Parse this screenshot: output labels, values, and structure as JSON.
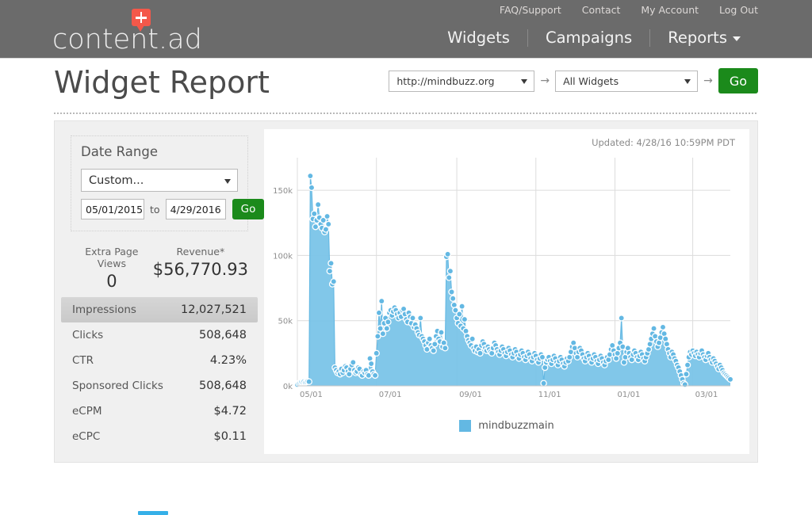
{
  "header": {
    "logo_text": "content.ad",
    "logo_icon": "speech-bubble-plus-icon",
    "top_links": [
      {
        "label": "FAQ/Support"
      },
      {
        "label": "Contact"
      },
      {
        "label": "My Account"
      },
      {
        "label": "Log Out"
      }
    ],
    "nav": [
      {
        "label": "Widgets",
        "has_caret": false
      },
      {
        "label": "Campaigns",
        "has_caret": false
      },
      {
        "label": "Reports",
        "has_caret": true
      }
    ]
  },
  "page": {
    "title": "Widget Report"
  },
  "selector": {
    "site_value": "http://mindbuzz.org",
    "widget_value": "All Widgets",
    "arrow": "→",
    "go_label": "Go"
  },
  "date_range": {
    "title": "Date Range",
    "preset_value": "Custom...",
    "start_date": "05/01/2015",
    "to_label": "to",
    "end_date": "4/29/2016",
    "go_label": "Go"
  },
  "top_stats": [
    {
      "label": "Extra Page Views",
      "value": "0"
    },
    {
      "label": "Revenue*",
      "value": "$56,770.93"
    }
  ],
  "metrics": [
    {
      "label": "Impressions",
      "value": "12,027,521",
      "highlight": true
    },
    {
      "label": "Clicks",
      "value": "508,648",
      "highlight": false
    },
    {
      "label": "CTR",
      "value": "4.23%",
      "highlight": false
    },
    {
      "label": "Sponsored Clicks",
      "value": "508,648",
      "highlight": false
    },
    {
      "label": "eCPM",
      "value": "$4.72",
      "highlight": false
    },
    {
      "label": "eCPC",
      "value": "$0.11",
      "highlight": false
    }
  ],
  "chart_panel": {
    "updated_text": "Updated: 4/28/16 10:59PM PDT"
  },
  "colors": {
    "series_blue": "#63b8e3",
    "series_fill": "#7ac4e8",
    "go_green": "#1b8a1b",
    "header_gray": "#6b6b6b",
    "logo_red": "#f4584a"
  },
  "chart_data": {
    "type": "area",
    "title": "",
    "xlabel": "",
    "ylabel": "",
    "grid": true,
    "legend_position": "bottom",
    "ylim": [
      0,
      175000
    ],
    "ytick_labels": [
      "0k",
      "50k",
      "100k",
      "150k"
    ],
    "ytick_values": [
      0,
      50000,
      100000,
      150000
    ],
    "xtick_labels": [
      "05/01",
      "07/01",
      "09/01",
      "11/01",
      "01/01",
      "03/01"
    ],
    "xtick_index": [
      0,
      61,
      123,
      184,
      245,
      305
    ],
    "series": [
      {
        "name": "mindbuzzmain",
        "color": "#63b8e3",
        "values": [
          1000,
          2000,
          2500,
          3000,
          2800,
          3200,
          2600,
          3000,
          3500,
          3200,
          161000,
          152000,
          128000,
          132000,
          122000,
          127000,
          139000,
          129000,
          124000,
          121000,
          127000,
          118000,
          120000,
          130000,
          124000,
          88000,
          94000,
          78000,
          80000,
          14000,
          12000,
          10000,
          11000,
          9000,
          13000,
          10000,
          12000,
          15000,
          14000,
          11000,
          9000,
          13000,
          16000,
          18000,
          12000,
          10000,
          11000,
          14000,
          13000,
          9000,
          8000,
          11000,
          10000,
          12000,
          9000,
          8000,
          21000,
          17000,
          11000,
          9000,
          8000,
          25000,
          38000,
          56000,
          44000,
          65000,
          40000,
          48000,
          52000,
          44000,
          49000,
          56000,
          58000,
          54000,
          57000,
          60000,
          58000,
          55000,
          52000,
          56000,
          53000,
          58000,
          59000,
          55000,
          51000,
          49000,
          56000,
          53000,
          48000,
          52000,
          45000,
          47000,
          44000,
          41000,
          39000,
          52000,
          38000,
          36000,
          34000,
          31000,
          28000,
          33000,
          36000,
          31000,
          29000,
          27000,
          32000,
          38000,
          42000,
          36000,
          34000,
          41000,
          30000,
          33000,
          29000,
          99000,
          101000,
          83000,
          88000,
          72000,
          67000,
          62000,
          58000,
          52000,
          48000,
          55000,
          46000,
          61000,
          44000,
          51000,
          42000,
          38000,
          35000,
          33000,
          31000,
          36000,
          29000,
          27000,
          30000,
          26000,
          28000,
          25000,
          31000,
          34000,
          32000,
          29000,
          27000,
          30000,
          28000,
          26000,
          25000,
          29000,
          33000,
          31000,
          28000,
          26000,
          24000,
          27000,
          30000,
          28000,
          25000,
          23000,
          26000,
          29000,
          27000,
          24000,
          22000,
          25000,
          28000,
          26000,
          23000,
          21000,
          24000,
          27000,
          25000,
          22000,
          20000,
          23000,
          26000,
          24000,
          21000,
          19000,
          22000,
          25000,
          23000,
          20000,
          18000,
          21000,
          24000,
          22000,
          2000,
          14000,
          18000,
          20000,
          22000,
          19000,
          17000,
          20000,
          23000,
          21000,
          18000,
          16000,
          19000,
          22000,
          20000,
          17000,
          15000,
          18000,
          21000,
          19000,
          22000,
          26000,
          30000,
          33000,
          29000,
          25000,
          22000,
          26000,
          29000,
          27000,
          24000,
          21000,
          19000,
          22000,
          25000,
          23000,
          20000,
          18000,
          21000,
          24000,
          22000,
          19000,
          17000,
          20000,
          23000,
          21000,
          18000,
          16000,
          19000,
          22000,
          20000,
          24000,
          28000,
          31000,
          27000,
          24000,
          21000,
          25000,
          29000,
          33000,
          52000,
          30000,
          18000,
          22000,
          26000,
          29000,
          25000,
          22000,
          20000,
          24000,
          27000,
          25000,
          22000,
          20000,
          23000,
          26000,
          24000,
          21000,
          19000,
          22000,
          25000,
          28000,
          32000,
          36000,
          40000,
          44000,
          38000,
          34000,
          30000,
          33000,
          37000,
          41000,
          45000,
          40000,
          36000,
          32000,
          28000,
          25000,
          22000,
          26000,
          24000,
          21000,
          19000,
          16000,
          14000,
          11000,
          8000,
          5000,
          2000,
          1000,
          9000,
          16000,
          22000,
          26000,
          24000,
          27000,
          25000,
          23000,
          26000,
          24000,
          22000,
          25000,
          27000,
          24000,
          22000,
          20000,
          23000,
          25000,
          22000,
          20000,
          18000,
          21000,
          19000,
          17000,
          15000,
          13000,
          16000,
          14000,
          12000,
          10000,
          9000,
          8000,
          7000,
          6000,
          5000
        ]
      }
    ]
  }
}
